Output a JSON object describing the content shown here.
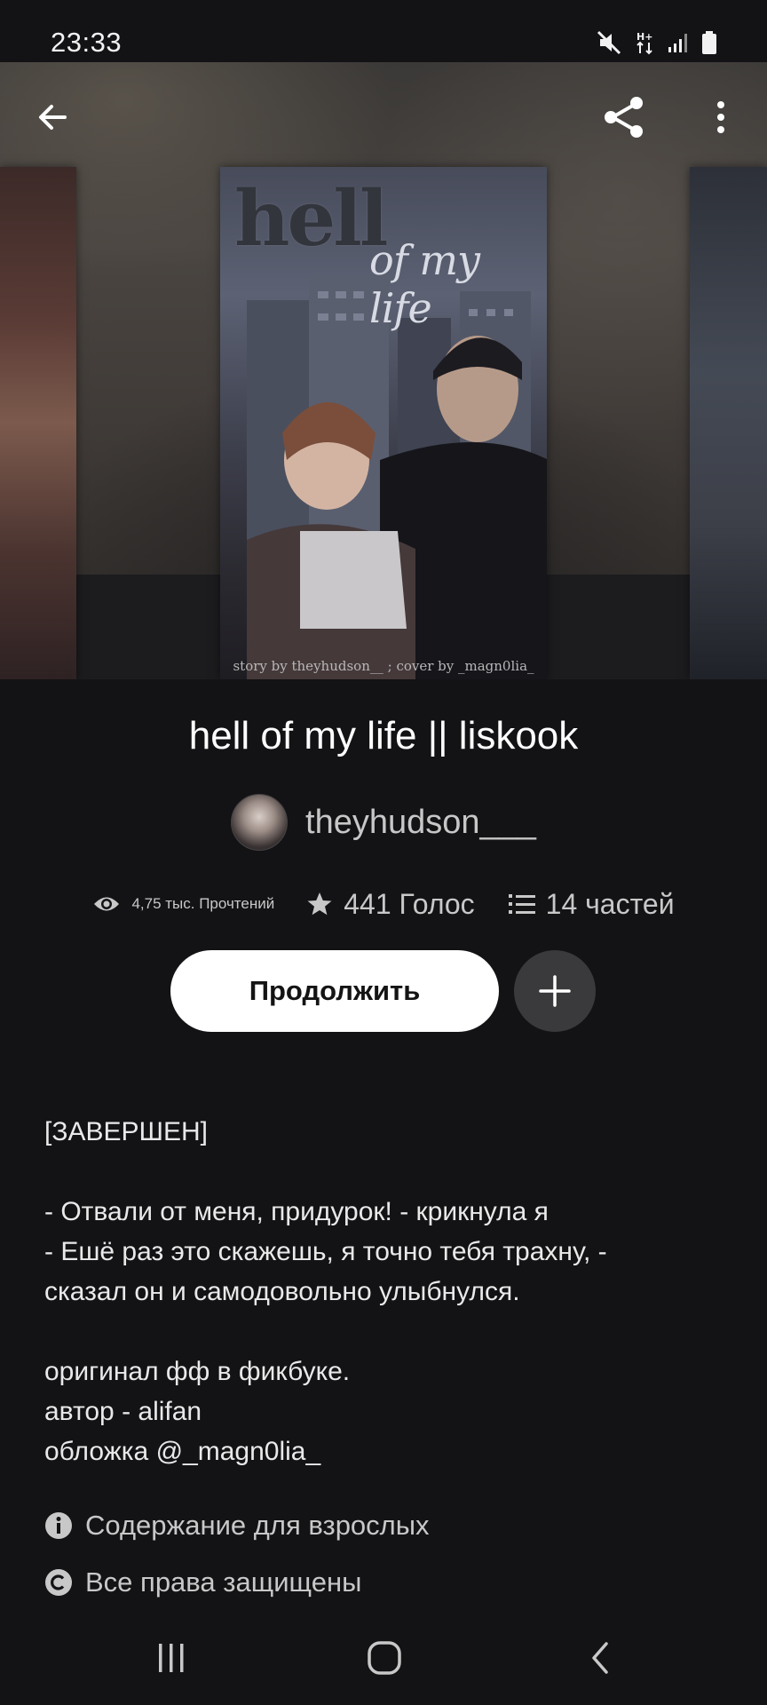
{
  "status_bar": {
    "time": "23:33",
    "icons": [
      "mute-icon",
      "data-arrows-icon",
      "signal-icon",
      "battery-icon"
    ]
  },
  "app_bar": {
    "back_icon": "arrow-left-icon",
    "share_icon": "share-icon",
    "more_icon": "more-vertical-icon"
  },
  "cover": {
    "title_word1": "hell",
    "title_word2": "of my life",
    "credit": "story by theyhudson__ ; cover by _magn0lia_"
  },
  "story": {
    "title": "hell of my life || liskook",
    "author": "theyhudson___",
    "stats": {
      "reads": "4,75 тыс. Прочтений",
      "votes": "441 Голос",
      "parts": "14 частей"
    },
    "continue_label": "Продолжить",
    "add_icon": "plus-icon",
    "description": "[ЗАВЕРШЕН]\n\n- Отвали от меня, придурок! - крикнула я\n- Ешё раз это скажешь, я точно тебя трахну, -\nсказал он и самодовольно улыбнулся.\n\nоригинал фф в фикбуке.\nавтор - alifan\nобложка @_magn0lia_",
    "mature_label": "Содержание для взрослых",
    "copyright_label": "Все права защищены"
  },
  "nav_bar": {
    "recents_icon": "recents-icon",
    "home_icon": "home-icon",
    "back_icon": "back-chevron-icon"
  },
  "colors": {
    "background": "#131215",
    "button_primary": "#ffffff",
    "button_secondary": "#3a393c",
    "text_secondary": "#c8c8c8"
  }
}
